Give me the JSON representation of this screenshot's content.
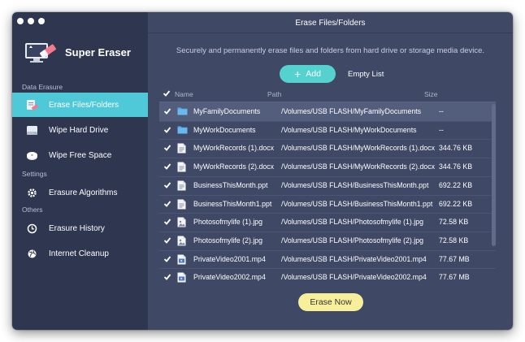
{
  "app": {
    "name": "Super Eraser"
  },
  "sidebar": {
    "sections": {
      "data_erasure": "Data Erasure",
      "settings": "Settings",
      "others": "Others"
    },
    "items": [
      {
        "label": "Erase Files/Folders",
        "icon": "erase-files-icon",
        "active": true
      },
      {
        "label": "Wipe Hard Drive",
        "icon": "hard-drive-icon",
        "active": false
      },
      {
        "label": "Wipe Free Space",
        "icon": "free-space-icon",
        "active": false
      },
      {
        "label": "Erasure Algorithms",
        "icon": "gear-icon",
        "active": false
      },
      {
        "label": "Erasure History",
        "icon": "clock-icon",
        "active": false
      },
      {
        "label": "Internet Cleanup",
        "icon": "globe-icon",
        "active": false
      }
    ]
  },
  "main": {
    "title": "Erase Files/Folders",
    "subtitle": "Securely and permanently erase files and folders from hard drive or storage media device.",
    "add_label": "Add",
    "empty_label": "Empty List",
    "columns": {
      "name": "Name",
      "path": "Path",
      "size": "Size"
    },
    "files": [
      {
        "name": "MyFamilyDocuments",
        "path": "/Volumes/USB FLASH/MyFamilyDocuments",
        "size": "--",
        "type": "folder",
        "checked": true
      },
      {
        "name": "MyWorkDocuments",
        "path": "/Volumes/USB FLASH/MyWorkDocuments",
        "size": "--",
        "type": "folder",
        "checked": true
      },
      {
        "name": "MyWorkRecords (1).docx",
        "path": "/Volumes/USB FLASH/MyWorkRecords (1).docx",
        "size": "344.76 KB",
        "type": "document",
        "checked": true
      },
      {
        "name": "MyWorkRecords (2).docx",
        "path": "/Volumes/USB FLASH/MyWorkRecords (2).docx",
        "size": "344.76 KB",
        "type": "document",
        "checked": true
      },
      {
        "name": "BusinessThisMonth.ppt",
        "path": "/Volumes/USB FLASH/BusinessThisMonth.ppt",
        "size": "692.22 KB",
        "type": "document",
        "checked": true
      },
      {
        "name": "BusinessThisMonth1.ppt",
        "path": "/Volumes/USB FLASH/BusinessThisMonth1.ppt",
        "size": "692.22 KB",
        "type": "document",
        "checked": true
      },
      {
        "name": "Photosofmylife (1).jpg",
        "path": "/Volumes/USB FLASH/Photosofmylife (1).jpg",
        "size": "72.58 KB",
        "type": "image",
        "checked": true
      },
      {
        "name": "Photosofmylife (2).jpg",
        "path": "/Volumes/USB FLASH/Photosofmylife (2).jpg",
        "size": "72.58 KB",
        "type": "image",
        "checked": true
      },
      {
        "name": "PrivateVideo2001.mp4",
        "path": "/Volumes/USB FLASH/PrivateVideo2001.mp4",
        "size": "77.67 MB",
        "type": "video",
        "checked": true
      },
      {
        "name": "PrivateVideo2002.mp4",
        "path": "/Volumes/USB FLASH/PrivateVideo2002.mp4",
        "size": "77.67 MB",
        "type": "video",
        "checked": true
      }
    ],
    "erase_label": "Erase Now"
  },
  "colors": {
    "sidebar_bg": "#2f3650",
    "main_bg": "#3f4865",
    "active_item": "#4fc8d7",
    "add_button": "#55d2cf",
    "erase_button": "#f7ef9a",
    "folder": "#5aa9e6"
  }
}
